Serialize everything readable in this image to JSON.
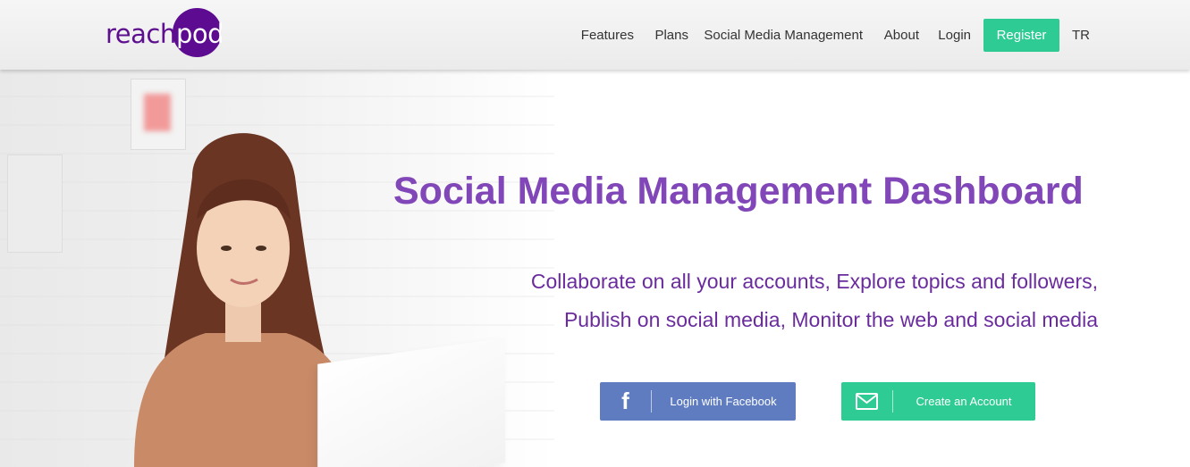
{
  "logo": {
    "part1": "reach",
    "part2": "pod"
  },
  "nav": {
    "items": [
      "Features",
      "Plans",
      "Social Media Management",
      "About",
      "Login"
    ],
    "register": "Register",
    "lang": "TR"
  },
  "hero": {
    "title": "Social Media Management Dashboard",
    "subtitle_line1": "Collaborate on all your accounts, Explore topics and followers,",
    "subtitle_line2": "Publish on social media, Monitor the web and social media"
  },
  "buttons": {
    "facebook": {
      "label": "Login with Facebook",
      "icon": "facebook-icon"
    },
    "create": {
      "label": "Create an Account",
      "icon": "envelope-icon"
    }
  },
  "colors": {
    "brand_purple": "#5d0c91",
    "title_purple": "#8147b8",
    "accent_green": "#2fcb94",
    "facebook_blue": "#5f7cc0"
  }
}
